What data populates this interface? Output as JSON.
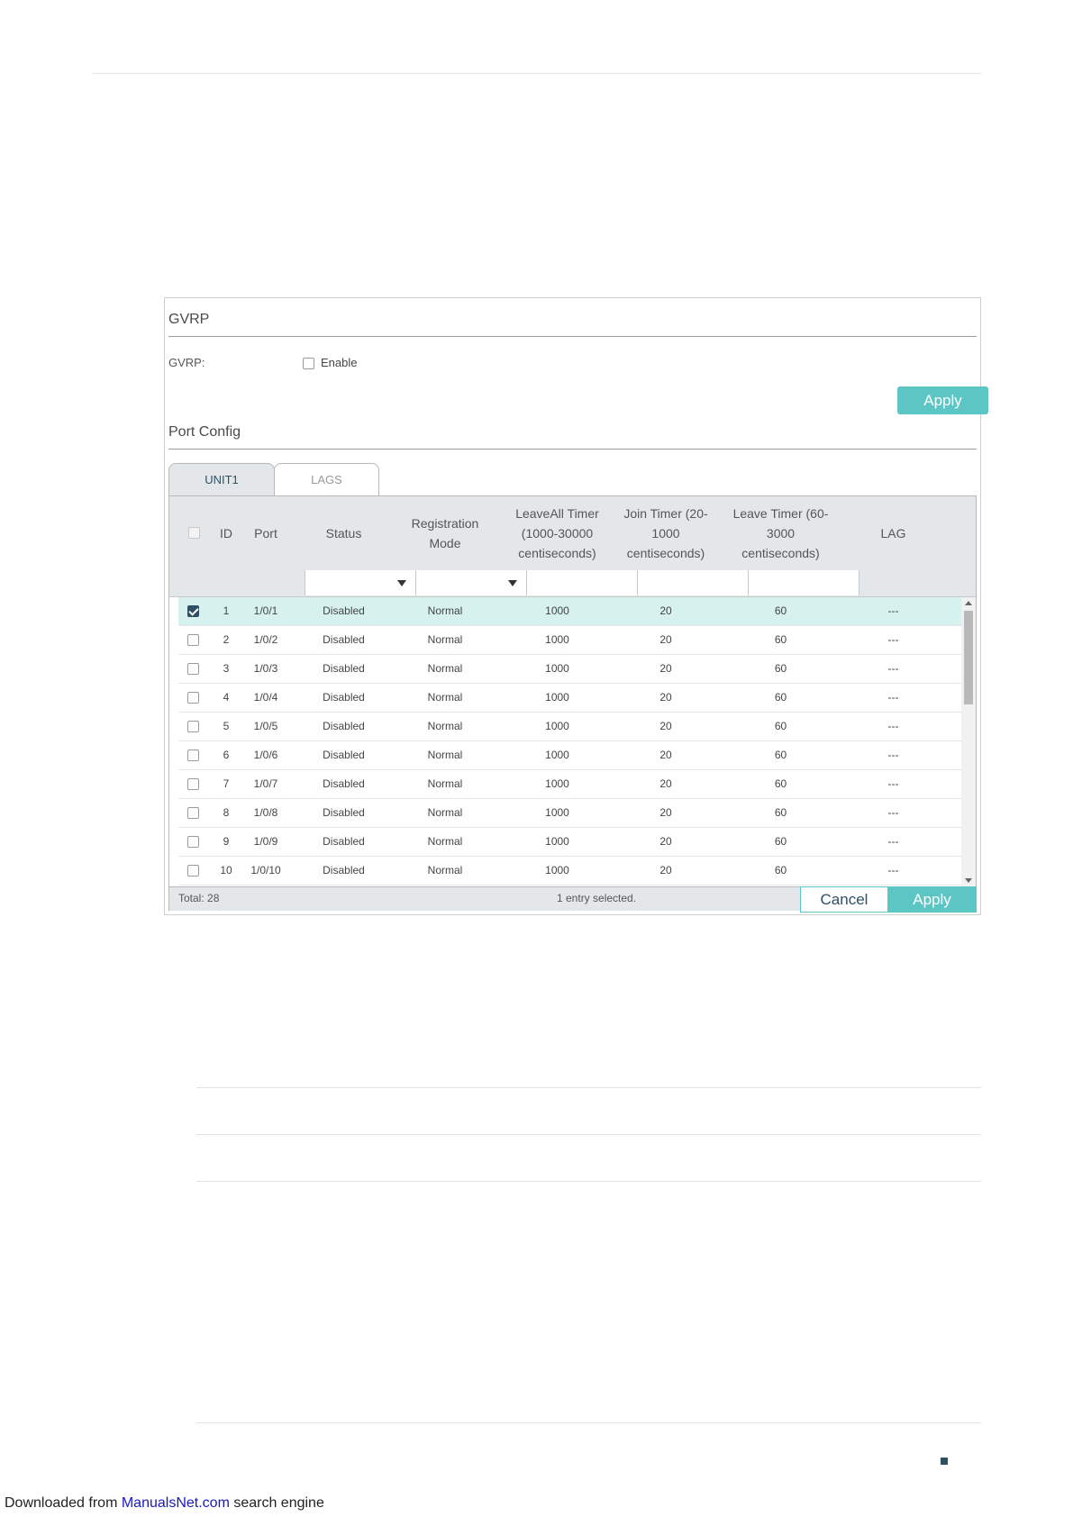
{
  "gvrp": {
    "section_title": "GVRP",
    "label": "GVRP:",
    "enable_label": "Enable",
    "enabled": false,
    "apply_label": "Apply"
  },
  "port_config": {
    "section_title": "Port Config",
    "tabs": [
      {
        "label": "UNIT1",
        "active": true
      },
      {
        "label": "LAGS",
        "active": false
      }
    ],
    "columns": {
      "id": "ID",
      "port": "Port",
      "status": "Status",
      "registration_mode": "Registration Mode",
      "leaveall_timer": "LeaveAll Timer (1000-30000 centiseconds)",
      "join_timer": "Join Timer (20-1000 centiseconds)",
      "leave_timer": "Leave Timer (60-3000 centiseconds)",
      "lag": "LAG"
    },
    "rows": [
      {
        "checked": true,
        "id": "1",
        "port": "1/0/1",
        "status": "Disabled",
        "mode": "Normal",
        "leaveall": "1000",
        "join": "20",
        "leave": "60",
        "lag": "---"
      },
      {
        "checked": false,
        "id": "2",
        "port": "1/0/2",
        "status": "Disabled",
        "mode": "Normal",
        "leaveall": "1000",
        "join": "20",
        "leave": "60",
        "lag": "---"
      },
      {
        "checked": false,
        "id": "3",
        "port": "1/0/3",
        "status": "Disabled",
        "mode": "Normal",
        "leaveall": "1000",
        "join": "20",
        "leave": "60",
        "lag": "---"
      },
      {
        "checked": false,
        "id": "4",
        "port": "1/0/4",
        "status": "Disabled",
        "mode": "Normal",
        "leaveall": "1000",
        "join": "20",
        "leave": "60",
        "lag": "---"
      },
      {
        "checked": false,
        "id": "5",
        "port": "1/0/5",
        "status": "Disabled",
        "mode": "Normal",
        "leaveall": "1000",
        "join": "20",
        "leave": "60",
        "lag": "---"
      },
      {
        "checked": false,
        "id": "6",
        "port": "1/0/6",
        "status": "Disabled",
        "mode": "Normal",
        "leaveall": "1000",
        "join": "20",
        "leave": "60",
        "lag": "---"
      },
      {
        "checked": false,
        "id": "7",
        "port": "1/0/7",
        "status": "Disabled",
        "mode": "Normal",
        "leaveall": "1000",
        "join": "20",
        "leave": "60",
        "lag": "---"
      },
      {
        "checked": false,
        "id": "8",
        "port": "1/0/8",
        "status": "Disabled",
        "mode": "Normal",
        "leaveall": "1000",
        "join": "20",
        "leave": "60",
        "lag": "---"
      },
      {
        "checked": false,
        "id": "9",
        "port": "1/0/9",
        "status": "Disabled",
        "mode": "Normal",
        "leaveall": "1000",
        "join": "20",
        "leave": "60",
        "lag": "---"
      },
      {
        "checked": false,
        "id": "10",
        "port": "1/0/10",
        "status": "Disabled",
        "mode": "Normal",
        "leaveall": "1000",
        "join": "20",
        "leave": "60",
        "lag": "---"
      }
    ],
    "total_label": "Total: 28",
    "selected_label": "1 entry selected.",
    "cancel_label": "Cancel",
    "apply_label": "Apply"
  },
  "footer": {
    "prefix": "Downloaded from ",
    "link": "ManualsNet.com",
    "suffix": " search engine"
  },
  "colors": {
    "accent": "#5cc6c4",
    "header_bg": "#e4e7ea",
    "selected_row": "#d7f1ef",
    "checkbox_checked": "#2f4f63"
  }
}
